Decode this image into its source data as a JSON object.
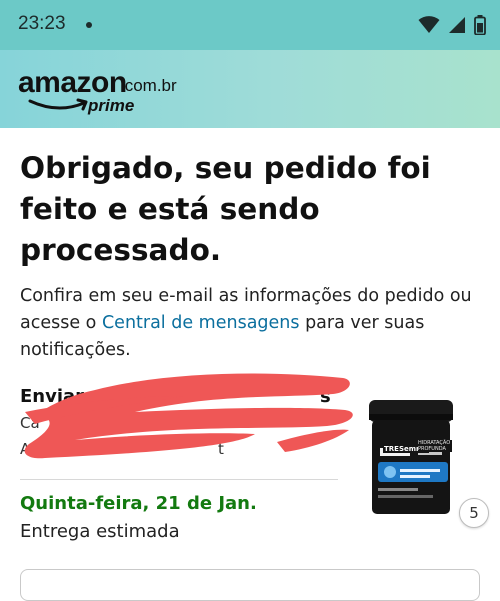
{
  "status_bar": {
    "time": "23:23",
    "icons": [
      "wifi-icon",
      "signal-icon",
      "battery-icon"
    ]
  },
  "header": {
    "logo_amazon": "amazon",
    "logo_domain": ".com.br",
    "logo_prime": "prime"
  },
  "confirmation": {
    "headline": "Obrigado, seu pedido foi feito e está sendo processado.",
    "info_prefix": "Confira em seu e-mail as informações do pedido ou acesse o ",
    "link_text": "Central de mensagens",
    "info_suffix": " para ver suas notificações."
  },
  "shipping": {
    "label": "Enviar p",
    "label_tail": "s",
    "line2": "Ca",
    "line3": "A",
    "line3_tail": "t"
  },
  "delivery": {
    "date": "Quinta-feira, 21 de Jan.",
    "label": "Entrega estimada"
  },
  "product": {
    "brand": "TRESemmé",
    "line": "HIDRATAÇÃO PROFUNDA",
    "quantity": "5"
  },
  "colors": {
    "status_bar": "#6cc9c7",
    "link": "#0b6f9e",
    "delivery_date": "#137a10",
    "redaction": "#ef5756"
  }
}
